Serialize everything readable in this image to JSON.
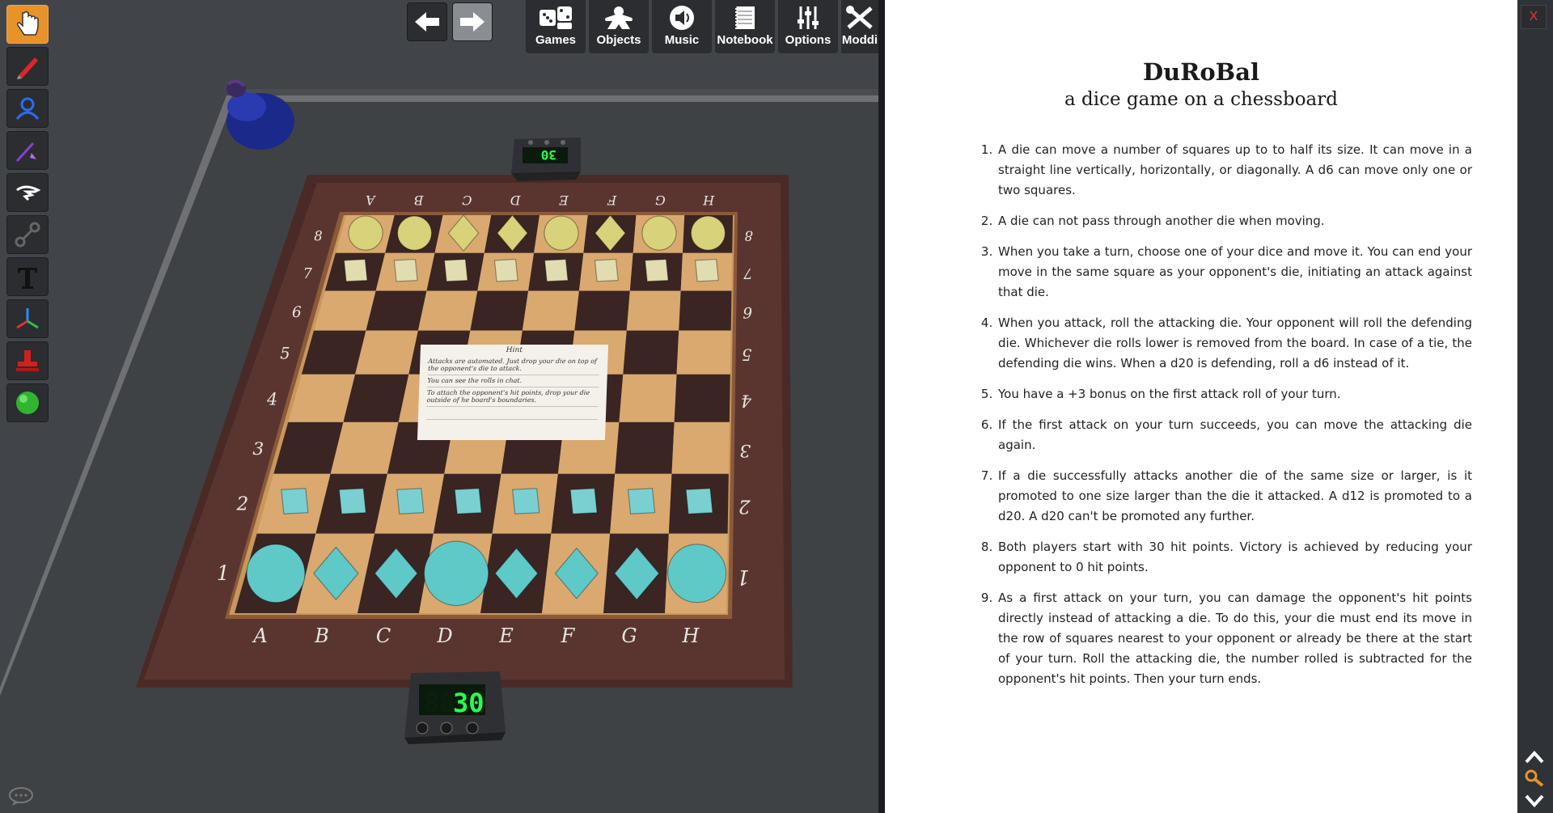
{
  "toolbar": {
    "back_icon": "arrow-left-icon",
    "forward_icon": "arrow-right-icon",
    "menu": [
      {
        "label": "Games",
        "icon": "dice-icon"
      },
      {
        "label": "Objects",
        "icon": "meeple-icon"
      },
      {
        "label": "Music",
        "icon": "speaker-icon"
      },
      {
        "label": "Notebook",
        "icon": "notebook-icon"
      },
      {
        "label": "Options",
        "icon": "sliders-icon"
      },
      {
        "label": "Moddi",
        "icon": "tools-icon"
      }
    ]
  },
  "left_tools": [
    "hand-icon",
    "pen-icon",
    "user-icon",
    "arrow-line-icon",
    "hidden-zone-icon",
    "joint-icon",
    "text-icon",
    "axes-icon",
    "stamp-icon",
    "ball-icon"
  ],
  "board": {
    "files_top": [
      "A",
      "B",
      "C",
      "D",
      "E",
      "F",
      "G",
      "H"
    ],
    "files_bottom": [
      "A",
      "B",
      "C",
      "D",
      "E",
      "F",
      "G",
      "H"
    ],
    "ranks": [
      "8",
      "7",
      "6",
      "5",
      "4",
      "3",
      "2",
      "1"
    ]
  },
  "counters": {
    "top": "30",
    "bottom": "30"
  },
  "hint": {
    "title": "Hint",
    "lines": [
      "Attacks are automated. Just drop your die on top of the opponent's die to attack.",
      "You can see the rolls in chat.",
      "To attach the opponent's hit points, drop your die outside of he board's boundaries."
    ]
  },
  "rules": {
    "title": "DuRoBal",
    "subtitle": "a dice game on a chessboard",
    "items": [
      "A die can move a number of squares up to to half its size. It can move in a straight line vertically, horizontally, or diagonally. A d6 can move only one or two squares.",
      "A die can not pass through another die when moving.",
      "When you take a turn, choose one of your dice and move it. You can end your move in the same square as your opponent's die, initiating an attack against that die.",
      "When you attack, roll the attacking die. Your opponent will roll the defending die. Whichever die rolls lower is removed from the board. In case of a tie, the defending die wins. When a d20 is defending, roll a d6 instead of it.",
      "You have a +3 bonus on the first attack roll of your turn.",
      "If the first attack on your turn succeeds, you can move the attacking die again.",
      "If a die successfully attacks another die of the same size or larger, is it promoted to one size larger than the die it attacked. A d12 is promoted to a d20. A d20 can't be promoted any further.",
      "Both players start with 30 hit points. Victory is achieved by reducing your opponent to 0 hit points.",
      "As a first attack on your turn, you can damage the opponent's hit points directly instead of attacking a die. To do this, your die must end its move in the row of squares nearest to your opponent or already be there at the start of your turn. Roll the attacking die, the number rolled is subtracted for the opponent's hit points. Then your turn ends."
    ]
  },
  "close_label": "X",
  "colors": {
    "accent": "#e8922a",
    "yellow_dice": "#d8d27a",
    "cyan_dice": "#5fc9c8",
    "lcd": "#27ff4f"
  }
}
